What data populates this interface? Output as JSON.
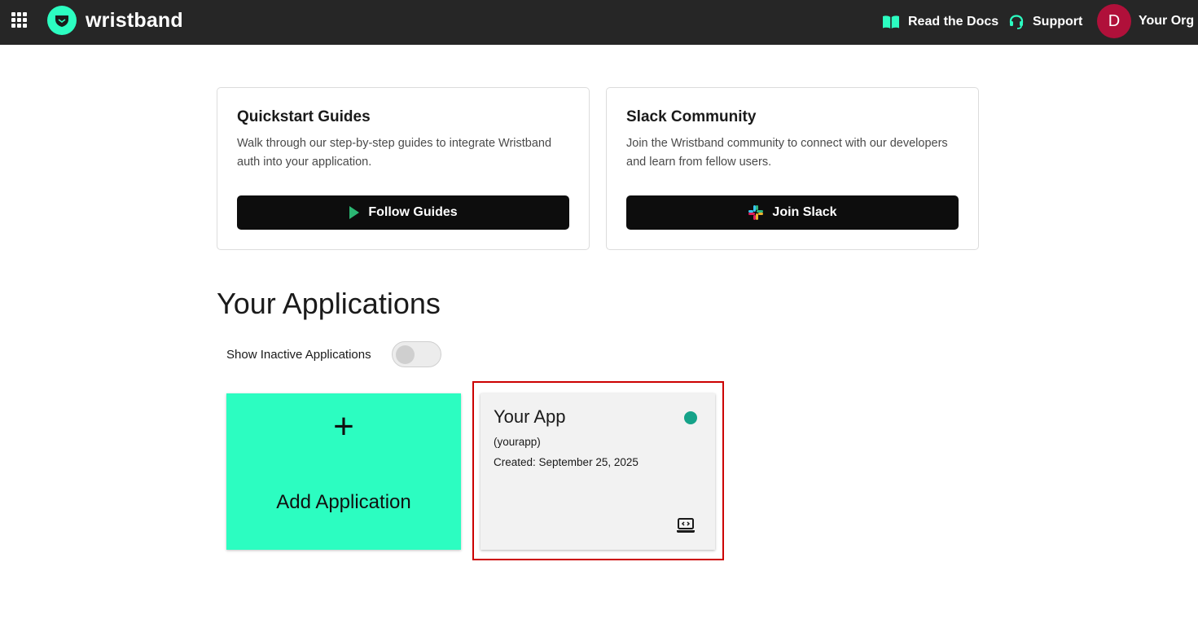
{
  "header": {
    "brand_name": "wristband",
    "docs_label": "Read the Docs",
    "support_label": "Support",
    "avatar_initial": "D",
    "org_name": "Your Org"
  },
  "cards": [
    {
      "title": "Quickstart Guides",
      "description": "Walk through our step-by-step guides to integrate Wristband auth into your application.",
      "button_label": "Follow Guides",
      "button_icon": "play-icon"
    },
    {
      "title": "Slack Community",
      "description": "Join the Wristband community to connect with our developers and learn from fellow users.",
      "button_label": "Join Slack",
      "button_icon": "slack-icon"
    }
  ],
  "applications": {
    "heading": "Your Applications",
    "toggle_label": "Show Inactive Applications",
    "toggle_on": false,
    "add_symbol": "+",
    "add_label": "Add Application",
    "items": [
      {
        "name": "Your App",
        "slug": "(yourapp)",
        "created": "Created: September 25, 2025",
        "status_color": "#16a389",
        "type_icon": "laptop-code-icon"
      }
    ]
  },
  "colors": {
    "accent": "#2cfdc1",
    "topbar": "#262626",
    "avatar": "#b0103a",
    "highlight": "#cc0000"
  }
}
